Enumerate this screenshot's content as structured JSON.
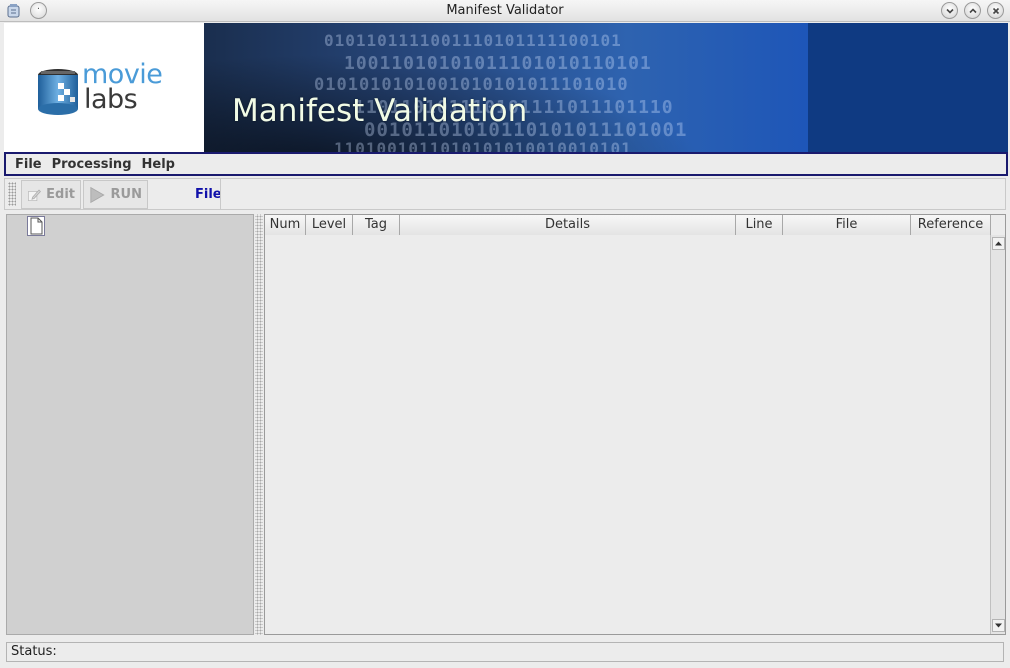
{
  "window": {
    "title": "Manifest Validator"
  },
  "banner": {
    "logo_word_top": "movie",
    "logo_word_bottom": "labs",
    "heading": "Manifest Validation",
    "binary_lines": [
      "0101101111001110101111100101",
      "10011010101011101010110101",
      "0101010101001010101011101010",
      "110110101110101111011101110",
      "00101101010110101011101001",
      "1101001011010101010010010101"
    ]
  },
  "menubar": {
    "items": [
      "File",
      "Processing",
      "Help"
    ]
  },
  "toolbar": {
    "edit_label": "Edit",
    "run_label": "RUN",
    "file_label": "File"
  },
  "table": {
    "columns": [
      "Num",
      "Level",
      "Tag",
      "Details",
      "Line",
      "File",
      "Reference"
    ],
    "rows": []
  },
  "status": {
    "label": "Status:"
  }
}
